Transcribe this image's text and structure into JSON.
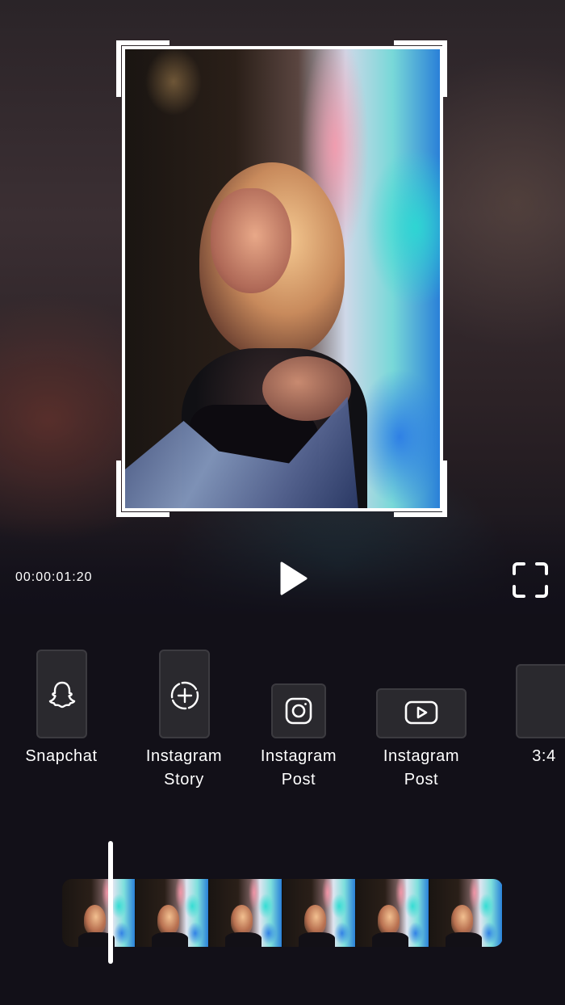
{
  "player": {
    "timecode": "00:00:01:20",
    "play_icon": "play-icon",
    "fullscreen_icon": "fullscreen-icon"
  },
  "presets": [
    {
      "id": "snapchat",
      "label": "Snapchat",
      "icon": "snapchat-ghost-icon"
    },
    {
      "id": "instagram-story",
      "label": "Instagram\nStory",
      "icon": "dashed-circle-plus-icon"
    },
    {
      "id": "instagram-post",
      "label": "Instagram\nPost",
      "icon": "instagram-icon"
    },
    {
      "id": "youtube",
      "label": "Instagram\nPost",
      "icon": "youtube-play-icon"
    },
    {
      "id": "ratio-3-4",
      "label": "3:4",
      "icon": ""
    }
  ],
  "timeline": {
    "thumbnail_count": 6
  },
  "colors": {
    "background": "#121018",
    "preset_box": "#2a292e",
    "accent": "#ffffff"
  }
}
